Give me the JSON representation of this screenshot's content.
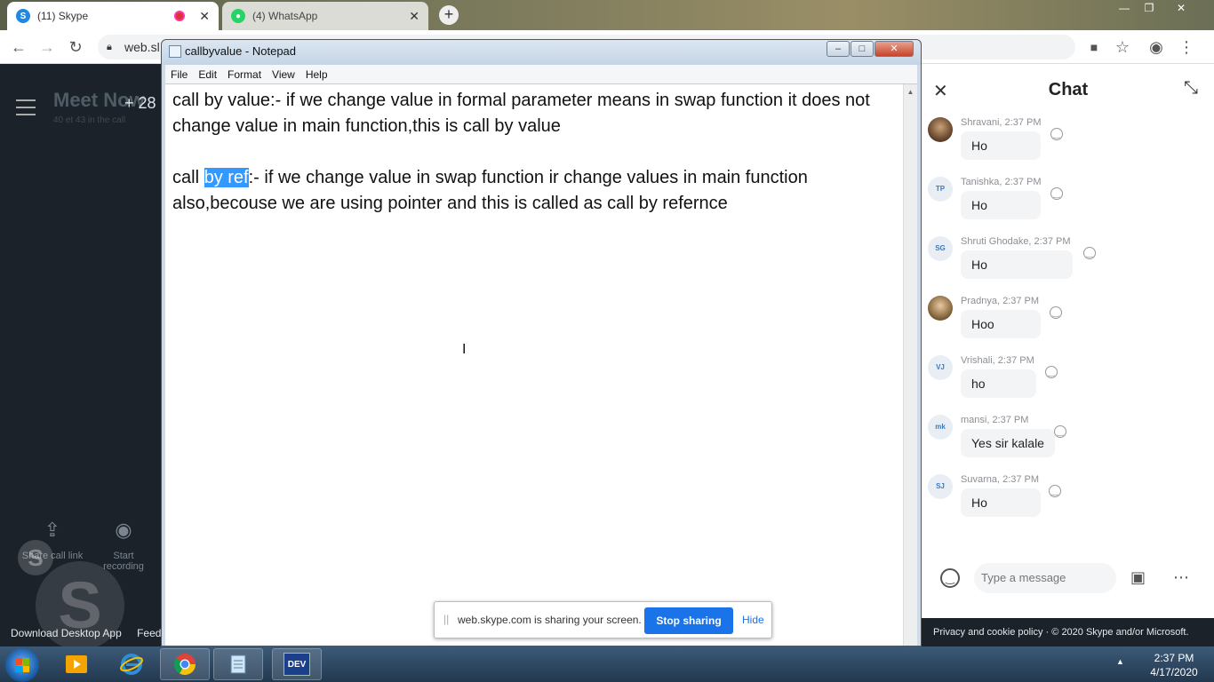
{
  "browser": {
    "tabs": [
      {
        "title": "(11) Skype",
        "active": true
      },
      {
        "title": "(4) WhatsApp",
        "active": false
      }
    ],
    "url": "web.sl"
  },
  "skype_left": {
    "meeting_title": "Meet Now",
    "meeting_subtitle": "40 et 43 in the call",
    "add_count": "+ 28",
    "share_link_label": "Share call link",
    "start_recording_label": "Start recording",
    "download_label": "Download Desktop App",
    "feedback_label": "Feedba"
  },
  "notepad": {
    "title": "callbyvalue - Notepad",
    "menu": [
      "File",
      "Edit",
      "Format",
      "View",
      "Help"
    ],
    "line1": "call by value:- if we change value in formal parameter means in swap function it does not change value in main function,this is call by value",
    "line2_before": "call ",
    "line2_selected": "by ref",
    "line2_after": ":- if we change value in swap function ir change values in main function also,becouse we are using pointer and this is called as call by refernce"
  },
  "sharebar": {
    "message": "web.skype.com is sharing your screen.",
    "stop_label": "Stop sharing",
    "hide_label": "Hide"
  },
  "chat": {
    "title": "Chat",
    "messages": [
      {
        "initials": "",
        "sender": "Shravani, 2:37 PM",
        "text": "Ho"
      },
      {
        "initials": "TP",
        "sender": "Tanishka, 2:37 PM",
        "text": "Ho"
      },
      {
        "initials": "SG",
        "sender": "Shruti Ghodake, 2:37 PM",
        "text": "Ho"
      },
      {
        "initials": "",
        "sender": "Pradnya, 2:37 PM",
        "text": "Hoo"
      },
      {
        "initials": "VJ",
        "sender": "Vrishali, 2:37 PM",
        "text": "ho"
      },
      {
        "initials": "mk",
        "sender": "mansi, 2:37 PM",
        "text": "Yes sir kalale"
      },
      {
        "initials": "SJ",
        "sender": "Suvarna, 2:37 PM",
        "text": "Ho"
      }
    ],
    "input_placeholder": "Type a message",
    "footer": "Privacy and cookie policy   ·   © 2020 Skype and/or Microsoft."
  },
  "taskbar": {
    "time": "2:37 PM",
    "date": "4/17/2020",
    "dev_label": "DEV"
  }
}
